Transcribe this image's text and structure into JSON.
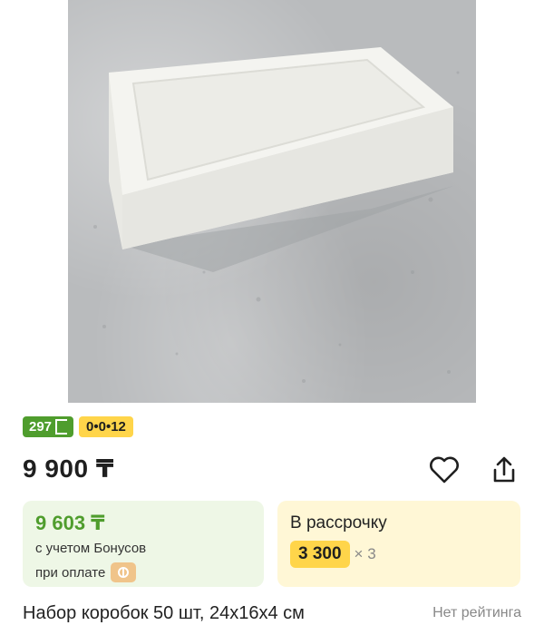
{
  "photo": {
    "alt_icon": "product-photo"
  },
  "badges": {
    "bonus": "297",
    "installment": "0•0•12"
  },
  "price": "9 900 ₸",
  "actions": {
    "favorite_icon": "heart-icon",
    "share_icon": "share-icon"
  },
  "bonus_card": {
    "price": "9 603 ₸",
    "line1": "с учетом Бонусов",
    "line2": "при оплате"
  },
  "credit_card": {
    "title": "В рассрочку",
    "amount": "3 300",
    "times": "× 3"
  },
  "product": {
    "title": "Набор коробок 50 шт, 24x16x4 см",
    "rating": "Нет рейтинга"
  },
  "colors": {
    "green": "#4f9d2d",
    "yellow": "#ffd54a"
  }
}
